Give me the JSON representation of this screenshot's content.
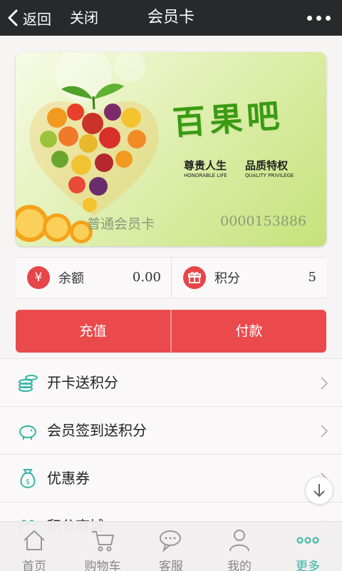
{
  "header": {
    "back_label": "返回",
    "close_label": "关闭",
    "title": "会员卡"
  },
  "card": {
    "brand_name": "百果吧",
    "slogans": [
      {
        "cn": "尊贵人生",
        "en": "HONORABLE LIFE"
      },
      {
        "cn": "品质特权",
        "en": "QUALITY PRIVILEGE"
      }
    ],
    "card_type": "普通会员卡",
    "card_number": "0000153886"
  },
  "stats": [
    {
      "icon": "yen-icon",
      "icon_glyph": "¥",
      "label": "余额",
      "value": "0.00"
    },
    {
      "icon": "gift-icon",
      "label": "积分",
      "value": "5"
    }
  ],
  "actions": {
    "recharge_label": "充值",
    "pay_label": "付款"
  },
  "menu": [
    {
      "icon": "coins-icon",
      "label": "开卡送积分"
    },
    {
      "icon": "piggy-bank-icon",
      "label": "会员签到送积分"
    },
    {
      "icon": "money-bag-icon",
      "label": "优惠券"
    },
    {
      "icon": "gift-box-icon",
      "label": "积分商城"
    }
  ],
  "tabbar": [
    {
      "icon": "home-icon",
      "label": "首页",
      "active": false
    },
    {
      "icon": "cart-icon",
      "label": "购物车",
      "active": false
    },
    {
      "icon": "chat-icon",
      "label": "客服",
      "active": false
    },
    {
      "icon": "user-icon",
      "label": "我的",
      "active": false
    },
    {
      "icon": "more-icon",
      "label": "更多",
      "active": true
    }
  ],
  "colors": {
    "header_bg": "#27292b",
    "accent_red": "#ea4a4c",
    "teal": "#35b6a5",
    "brand_green": "#3a9a14"
  }
}
